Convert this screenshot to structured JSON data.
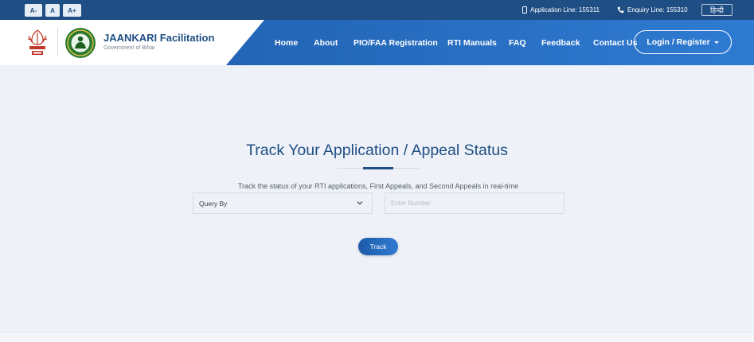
{
  "topbar": {
    "font_decrease": "A-",
    "font_normal": "A",
    "font_increase": "A+",
    "application_line": "Application Line: 155311",
    "enquiry_line": "Enquiry Line: 155310",
    "language": "हिन्दी"
  },
  "header": {
    "brand_title": "JAANKARI Facilitation",
    "brand_subtitle": "Government of Bihar",
    "nav": [
      "Home",
      "About",
      "PIO/FAA Registration",
      "RTI Manuals",
      "FAQ",
      "Feedback",
      "Contact Us"
    ],
    "login_label": "Login / Register"
  },
  "main": {
    "title": "Track Your Application / Appeal Status",
    "subtitle": "Track the status of your RTI applications, First Appeals, and Second Appeals in real-time",
    "query_select_value": "Query By",
    "number_placeholder": "Enter Number",
    "track_label": "Track"
  },
  "colors": {
    "primary": "#1f4e84",
    "accent": "#2f7bd2",
    "background": "#eef2f8"
  }
}
